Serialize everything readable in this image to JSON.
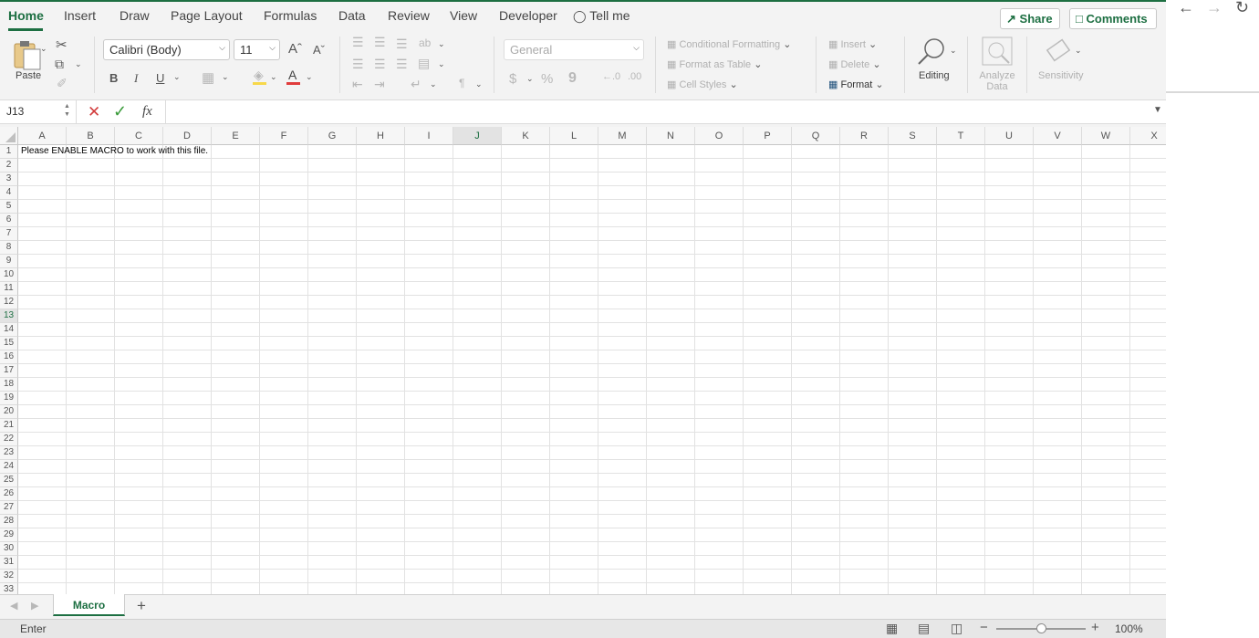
{
  "ribbon_tabs": [
    "Home",
    "Insert",
    "Draw",
    "Page Layout",
    "Formulas",
    "Data",
    "Review",
    "View",
    "Developer"
  ],
  "tell_me": "Tell me",
  "share": "Share",
  "comments": "Comments",
  "clipboard": {
    "paste": "Paste"
  },
  "font": {
    "name": "Calibri (Body)",
    "size": "11",
    "bold": "B",
    "italic": "I",
    "underline": "U"
  },
  "number": {
    "format": "General",
    "currency": "$",
    "percent": "%",
    "comma": "9"
  },
  "styles": {
    "conditional": "Conditional Formatting",
    "format_table": "Format as Table",
    "cell_styles": "Cell Styles"
  },
  "cells": {
    "insert": "Insert",
    "delete": "Delete",
    "format": "Format"
  },
  "editing": "Editing",
  "analyze": [
    "Analyze",
    "Data"
  ],
  "sensitivity": "Sensitivity",
  "formula_bar": {
    "name_box": "J13",
    "fx": "fx",
    "formula": ""
  },
  "columns": [
    "A",
    "B",
    "C",
    "D",
    "E",
    "F",
    "G",
    "H",
    "I",
    "J",
    "K",
    "L",
    "M",
    "N",
    "O",
    "P",
    "Q",
    "R",
    "S",
    "T",
    "U",
    "V",
    "W",
    "X"
  ],
  "rows": [
    "1",
    "2",
    "3",
    "4",
    "5",
    "6",
    "7",
    "8",
    "9",
    "10",
    "11",
    "12",
    "13",
    "14",
    "15",
    "16",
    "17",
    "18",
    "19",
    "20",
    "21",
    "22",
    "23",
    "24",
    "25",
    "26",
    "27",
    "28",
    "29",
    "30",
    "31",
    "32",
    "33"
  ],
  "active_cell": {
    "column": "J",
    "row": "13"
  },
  "cell_a1": "Please ENABLE MACRO to work with this file.",
  "sheets": [
    "Macro"
  ],
  "status": {
    "mode": "Enter",
    "zoom": "100%",
    "zoom_level": 0.5
  },
  "colors": {
    "accent": "#1d6f42",
    "font_color": "#e03c3c",
    "fill_color": "#f7d84a"
  }
}
